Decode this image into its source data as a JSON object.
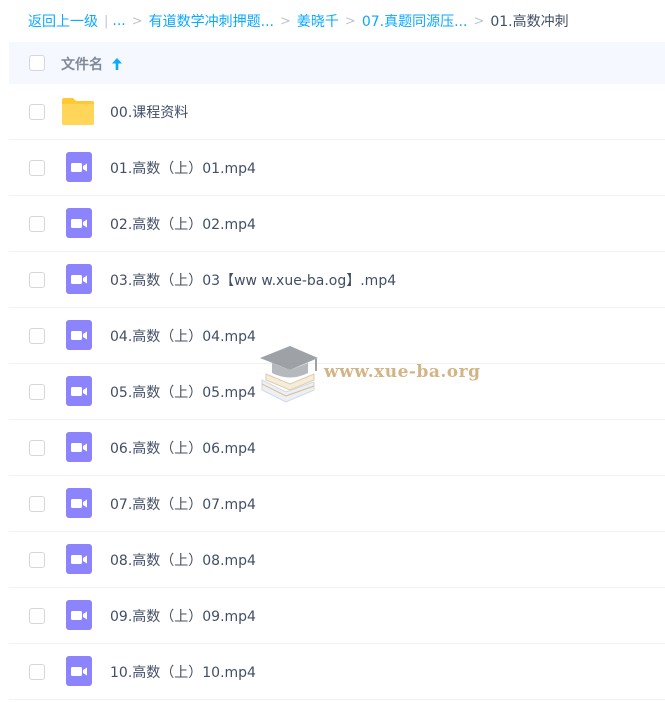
{
  "breadcrumb": {
    "back_label": "返回上一级",
    "divider": "|",
    "ellipsis": "...",
    "sep": ">",
    "crumbs": [
      "有道数学冲刺押题...",
      "姜晓千",
      "07.真题同源压..."
    ],
    "current": "01.高数冲刺"
  },
  "table": {
    "column_name_label": "文件名",
    "sort_direction": "ascending"
  },
  "files": [
    {
      "name": "00.课程资料",
      "icon": "folder-icon"
    },
    {
      "name": "01.高数（上）01.mp4",
      "icon": "video-icon"
    },
    {
      "name": "02.高数（上）02.mp4",
      "icon": "video-icon"
    },
    {
      "name": "03.高数（上）03【ww w.xue-ba.og】.mp4",
      "icon": "video-icon"
    },
    {
      "name": "04.高数（上）04.mp4",
      "icon": "video-icon"
    },
    {
      "name": "05.高数（上）05.mp4",
      "icon": "video-icon"
    },
    {
      "name": "06.高数（上）06.mp4",
      "icon": "video-icon"
    },
    {
      "name": "07.高数（上）07.mp4",
      "icon": "video-icon"
    },
    {
      "name": "08.高数（上）08.mp4",
      "icon": "video-icon"
    },
    {
      "name": "09.高数（上）09.mp4",
      "icon": "video-icon"
    },
    {
      "name": "10.高数（上）10.mp4",
      "icon": "video-icon"
    }
  ],
  "watermark": {
    "text": "www.xue-ba.org"
  },
  "colors": {
    "link": "#09aaff",
    "header_bg": "#f5f8ff",
    "folder": "#ffd659",
    "video": "#8c83ff",
    "text": "#424e67"
  }
}
